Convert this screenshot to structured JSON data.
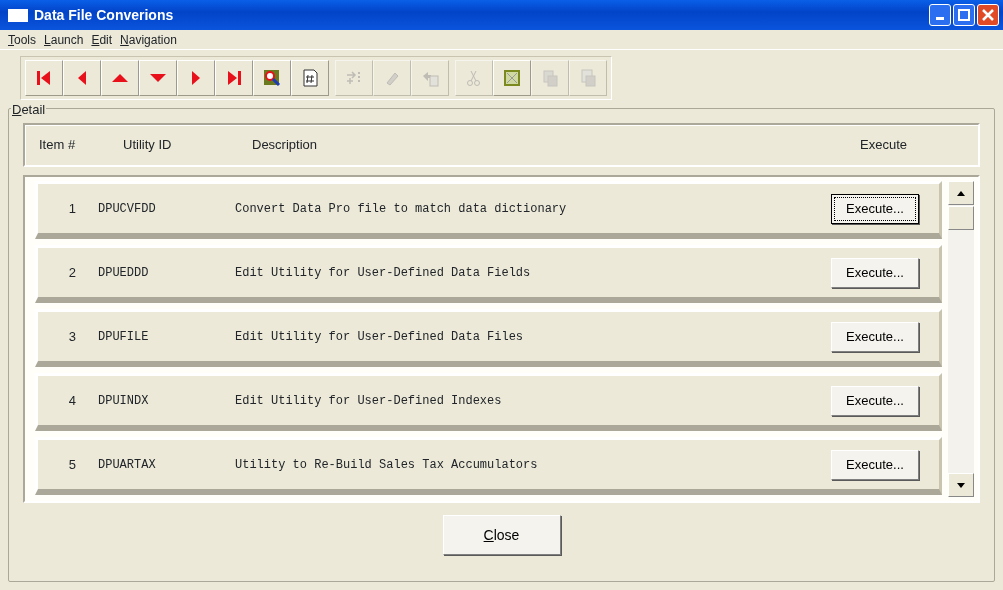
{
  "window": {
    "title": "Data File Converions"
  },
  "menu": [
    "Tools",
    "Launch",
    "Edit",
    "Navigation"
  ],
  "toolbar": [
    {
      "buttons": [
        {
          "kind": "first",
          "disabled": false
        },
        {
          "kind": "prev",
          "disabled": false
        },
        {
          "kind": "up",
          "disabled": false
        },
        {
          "kind": "down",
          "disabled": false
        },
        {
          "kind": "next",
          "disabled": false
        },
        {
          "kind": "last",
          "disabled": false
        },
        {
          "kind": "find",
          "disabled": false
        },
        {
          "kind": "number",
          "disabled": false
        }
      ]
    },
    {
      "buttons": [
        {
          "kind": "insert",
          "disabled": true
        },
        {
          "kind": "erase",
          "disabled": true
        },
        {
          "kind": "paste-in",
          "disabled": true
        }
      ]
    },
    {
      "buttons": [
        {
          "kind": "cut",
          "disabled": true
        },
        {
          "kind": "clear",
          "disabled": false
        },
        {
          "kind": "copy",
          "disabled": true
        },
        {
          "kind": "paste",
          "disabled": true
        }
      ]
    }
  ],
  "detail": {
    "label": "Detail",
    "columns": [
      "Item #",
      "Utility ID",
      "Description",
      "Execute"
    ],
    "rows": [
      {
        "item": "1",
        "utility_id": "DPUCVFDD",
        "description": "Convert Data Pro file to match data dictionary",
        "button": "Execute...",
        "focused": true
      },
      {
        "item": "2",
        "utility_id": "DPUEDDD",
        "description": "Edit Utility for User-Defined Data Fields",
        "button": "Execute...",
        "focused": false
      },
      {
        "item": "3",
        "utility_id": "DPUFILE",
        "description": "Edit Utility for User-Defined Data Files",
        "button": "Execute...",
        "focused": false
      },
      {
        "item": "4",
        "utility_id": "DPUINDX",
        "description": "Edit Utility for User-Defined Indexes",
        "button": "Execute...",
        "focused": false
      },
      {
        "item": "5",
        "utility_id": "DPUARTAX",
        "description": "Utility to Re-Build Sales Tax Accumulators",
        "button": "Execute...",
        "focused": false
      }
    ]
  },
  "close_button": "Close"
}
